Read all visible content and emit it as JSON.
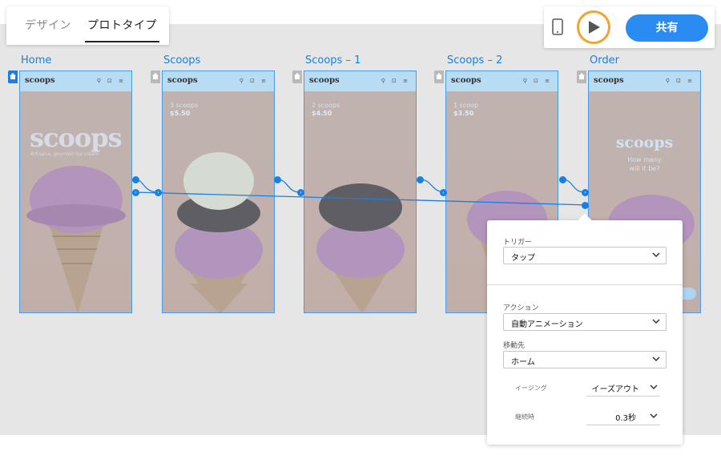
{
  "mode_tabs": {
    "design": "デザイン",
    "prototype": "プロトタイプ"
  },
  "toolbar": {
    "share_label": "共有"
  },
  "artboards": [
    {
      "name": "Home",
      "logo": "scoops",
      "big_logo": "scoops",
      "tagline": "Artisana, gourmet ice cream"
    },
    {
      "name": "Scoops",
      "logo": "scoops",
      "count": "3 scoops",
      "price": "$5.50"
    },
    {
      "name": "Scoops – 1",
      "logo": "scoops",
      "count": "2 scoops",
      "price": "$4.50"
    },
    {
      "name": "Scoops – 2",
      "logo": "scoops",
      "count": "1 scoop",
      "price": "$3.50"
    },
    {
      "name": "Order",
      "logo": "scoops",
      "big_logo": "scoops",
      "question_1": "How many",
      "question_2": "will it be?"
    }
  ],
  "header_icons": "⚲ ⊡ ≡",
  "panel": {
    "trigger_label": "トリガー",
    "trigger_value": "タップ",
    "action_label": "アクション",
    "action_value": "自動アニメーション",
    "destination_label": "移動先",
    "destination_value": "ホーム",
    "easing_label": "イージング",
    "easing_value": "イーズアウト",
    "duration_label": "継続時",
    "duration_value": "0.3秒"
  },
  "colors": {
    "accent": "#1a7fe0",
    "share": "#2a8bf0",
    "play_ring": "#f0a52e"
  }
}
